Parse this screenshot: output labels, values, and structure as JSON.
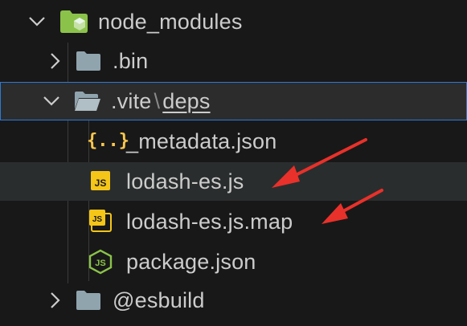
{
  "explorer": {
    "node_modules": {
      "label": "node_modules",
      "icon": "node-modules-folder-icon",
      "state": "expanded"
    },
    "bin": {
      "label": ".bin",
      "icon": "folder-icon",
      "state": "collapsed"
    },
    "vite": {
      "label": ".vite",
      "separator": "\\",
      "child_label": "deps",
      "icon": "folder-open-icon",
      "state": "expanded"
    },
    "files": [
      {
        "label": "_metadata.json",
        "icon": "json-braces-icon"
      },
      {
        "label": "lodash-es.js",
        "icon": "js-file-icon"
      },
      {
        "label": "lodash-es.js.map",
        "icon": "js-map-file-icon"
      },
      {
        "label": "package.json",
        "icon": "node-js-icon"
      }
    ],
    "esbuild": {
      "label": "@esbuild",
      "icon": "folder-icon",
      "state": "collapsed"
    }
  },
  "colors": {
    "background": "#181818",
    "row_hover": "#2a2d2e",
    "focus_border": "#2b79d8",
    "annotation_arrow": "#e8312a"
  }
}
